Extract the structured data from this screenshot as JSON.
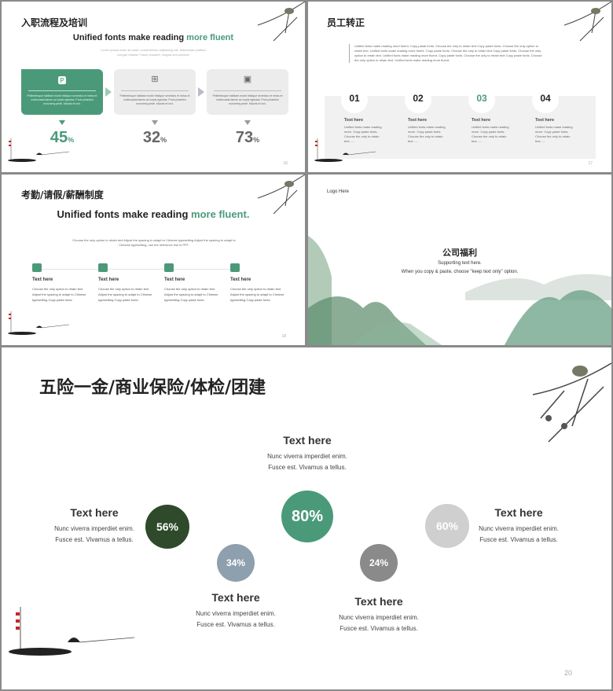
{
  "colors": {
    "accent": "#4a9a7a",
    "dark_green": "#2f4a2a",
    "blue_grey": "#8e9fae",
    "grey": "#8a8a8a",
    "light_grey": "#cfcfcf"
  },
  "slide16": {
    "title": "入职流程及培训",
    "headline_a": "Unified fonts make reading ",
    "headline_b": "more fluent",
    "sub": "Lorem ipsum dolor sit amet, consectetuer adipiscing elit. Maecenas porttitor congue massa. Fusce posuere, magna sed pulvinar",
    "cards": [
      {
        "icon": "powerpoint-file-icon",
        "text": "Pellentesque habitant morbi tristique senectus et netus et malesuada fames ac turpis egestas. Proin pharetra nonummy pede. Mauris et orci.",
        "value": "45",
        "unit": "%"
      },
      {
        "icon": "org-chart-icon",
        "text": "Pellentesque habitant morbi tristique senectus et netus et malesuada fames ac turpis egestas. Proin pharetra nonummy pede. Mauris et orci.",
        "value": "32",
        "unit": "%"
      },
      {
        "icon": "image-icon",
        "text": "Pellentesque habitant morbi tristique senectus et netus et malesuada fames ac turpis egestas. Proin pharetra nonummy pede. Mauris et orci.",
        "value": "73",
        "unit": "%"
      }
    ],
    "page": "16"
  },
  "slide17": {
    "title": "员工转正",
    "paragraph": "Unified fonts make reading more fluent. Copy paste fonts. Choose the only to retain text Copy paste fonts. Choose the only option to retain text. Unified fonts make reading more fluent. Copy paste fonts. Choose the only to retain text Copy paste fonts. Choose the only option to retain text. Unified fonts make reading more fluent. Copy paste fonts. Choose the only to retain text Copy paste fonts. Choose the only option to retain text. Unified fonts make reading more fluent.",
    "steps": [
      {
        "num": "01",
        "title": "Text here",
        "text": "Unified fonts make reading more. Copy paste fonts. Choose the only to retain text......"
      },
      {
        "num": "02",
        "title": "Text here",
        "text": "Unified fonts make reading more. Copy paste fonts. Choose the only to retain text......"
      },
      {
        "num": "03",
        "title": "Text here",
        "text": "Unified fonts make reading more. Copy paste fonts. Choose the only to retain text......"
      },
      {
        "num": "04",
        "title": "Text here",
        "text": "Unified fonts make reading more. Copy paste fonts. Choose the only to retain text......"
      }
    ],
    "page": "17"
  },
  "slide18": {
    "title": "考勤/请假/薪酬制度",
    "headline_a": "Unified fonts make reading ",
    "headline_b": "more fluent.",
    "sub": "Choose the only option to retain text Adjust the spacing to adapt to Chinese typesetting Adjust the spacing to adapt to Chinese typesetting, use the reference line in PPT.",
    "items": [
      {
        "icon": "powerpoint-file-icon",
        "title": "Text here",
        "text": "Choose the only option to retain text Adjust the spacing to adapt to Chinese typesetting Copy paste fonts."
      },
      {
        "icon": "briefcase-icon",
        "title": "Text here",
        "text": "Choose the only option to retain text Adjust the spacing to adapt to Chinese typesetting Copy paste fonts."
      },
      {
        "icon": "printer-icon",
        "title": "Text here",
        "text": "Choose the only option to retain text Adjust the spacing to adapt to Chinese typesetting Copy paste fonts."
      },
      {
        "icon": "sofa-icon",
        "title": "Text here",
        "text": "Choose the only option to retain text Adjust the spacing to adapt to Chinese typesetting Copy paste fonts."
      }
    ],
    "page": "18"
  },
  "slide19": {
    "logo": "Logo Here",
    "title": "公司福利",
    "sub1": "Supporting text here.",
    "sub2": "When you copy & paste, choose \"keep text only\" option."
  },
  "slide20": {
    "title": "五险一金/商业保险/体检/团建",
    "circles": [
      {
        "value": "56%",
        "title": "Text here",
        "line1": "Nunc viverra imperdiet enim.",
        "line2": "Fusce est. Vivamus a tellus."
      },
      {
        "value": "34%",
        "title": "Text here",
        "line1": "Nunc viverra imperdiet enim.",
        "line2": "Fusce est. Vivamus a tellus."
      },
      {
        "value": "80%",
        "title": "Text here",
        "line1": "Nunc viverra imperdiet enim.",
        "line2": "Fusce est. Vivamus a tellus."
      },
      {
        "value": "24%",
        "title": "Text here",
        "line1": "Nunc viverra imperdiet enim.",
        "line2": "Fusce est. Vivamus a tellus."
      },
      {
        "value": "60%",
        "title": "Text here",
        "line1": "Nunc viverra imperdiet enim.",
        "line2": "Fusce est. Vivamus a tellus."
      }
    ],
    "page": "20"
  }
}
